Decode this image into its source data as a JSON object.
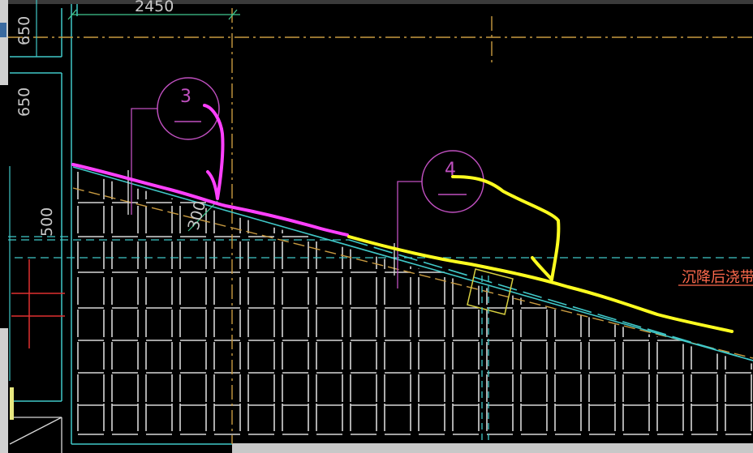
{
  "drawing": {
    "top_dimension": "2450",
    "left_dimensions": [
      "650",
      "650",
      "500"
    ],
    "slope_dimension": "300",
    "callouts": [
      {
        "number": "3",
        "color": "#c050c0"
      },
      {
        "number": "4",
        "color": "#c050c0"
      }
    ],
    "band_label": "沉降后浇带",
    "colors": {
      "background": "#000000",
      "grid": "#d8d8d8",
      "axis": "#c89a40",
      "cyan": "#40c8c8",
      "magenta_mark": "#ff40ff",
      "yellow_mark": "#ffff20",
      "label_red": "#ff6a4d"
    }
  }
}
